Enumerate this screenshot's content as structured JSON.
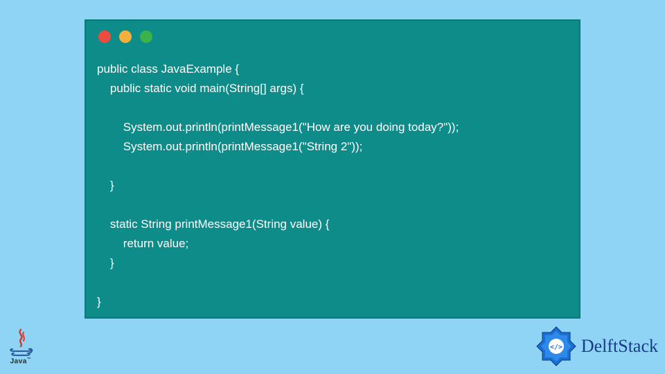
{
  "code": {
    "lines": [
      "public class JavaExample {",
      "    public static void main(String[] args) {",
      "",
      "        System.out.println(printMessage1(\"How are you doing today?\"));",
      "        System.out.println(printMessage1(\"String 2\"));",
      "",
      "    }",
      "",
      "    static String printMessage1(String value) {",
      "        return value;",
      "    }",
      "",
      "}"
    ]
  },
  "logos": {
    "java_label": "Java",
    "delftstack_label": "DelftStack"
  },
  "colors": {
    "background": "#8fd4f4",
    "window": "#0e8c8a",
    "code_text": "#ffffff",
    "delft_blue": "#1a3a8a"
  }
}
